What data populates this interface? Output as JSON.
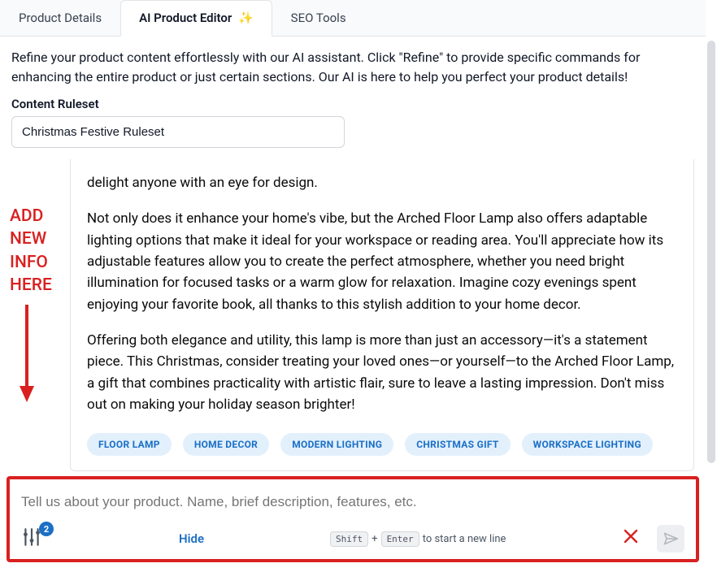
{
  "tabs": [
    {
      "label": "Product Details",
      "active": false
    },
    {
      "label": "AI Product Editor",
      "active": true,
      "sparkle": "✨"
    },
    {
      "label": "SEO Tools",
      "active": false
    }
  ],
  "description": "Refine your product content effortlessly with our AI assistant. Click \"Refine\" to provide specific commands for enhancing the entire product or just certain sections. Our AI is here to help you perfect your product details!",
  "ruleset": {
    "label": "Content Ruleset",
    "selected": "Christmas Festive Ruleset"
  },
  "annotation": {
    "line1": "ADD",
    "line2": "NEW",
    "line3": "INFO",
    "line4": "HERE"
  },
  "paragraphs": {
    "p0": "delight anyone with an eye for design.",
    "p1": "Not only does it enhance your home's vibe, but the Arched Floor Lamp also offers adaptable lighting options that make it ideal for your workspace or reading area. You'll appreciate how its adjustable features allow you to create the perfect atmosphere, whether you need bright illumination for focused tasks or a warm glow for relaxation. Imagine cozy evenings spent enjoying your favorite book, all thanks to this stylish addition to your home decor.",
    "p2": "Offering both elegance and utility, this lamp is more than just an accessory—it's a statement piece. This Christmas, consider treating your loved ones—or yourself—to the Arched Floor Lamp, a gift that combines practicality with artistic flair, sure to leave a lasting impression. Don't miss out on making your holiday season brighter!"
  },
  "tags": [
    "FLOOR LAMP",
    "HOME DECOR",
    "MODERN LIGHTING",
    "CHRISTMAS GIFT",
    "WORKSPACE LIGHTING"
  ],
  "input": {
    "placeholder": "Tell us about your product. Name, brief description, features, etc.",
    "badge_count": "2",
    "hide_label": "Hide",
    "kbd_shift": "Shift",
    "kbd_plus": "+",
    "kbd_enter": "Enter",
    "kbd_hint_tail": "to start a new line"
  }
}
